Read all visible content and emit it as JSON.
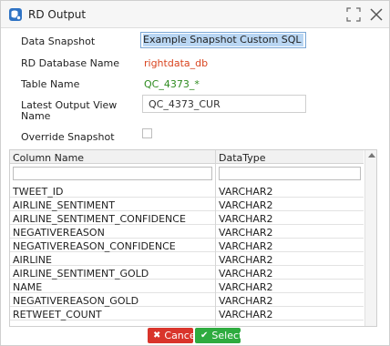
{
  "window": {
    "title": "RD Output"
  },
  "form": {
    "data_snapshot_label": "Data Snapshot",
    "data_snapshot_value": "Example Snapshot Custom SQL Result",
    "database_label": "RD Database Name",
    "database_value": "rightdata_db",
    "table_label": "Table Name",
    "table_value": "QC_4373_*",
    "view_label_line1": "Latest Output View",
    "view_label_line2": "Name",
    "view_value": "QC_4373_CUR",
    "override_label": "Override Snapshot",
    "override_checked": false
  },
  "grid": {
    "columns": [
      "Column Name",
      "DataType"
    ],
    "rows": [
      [
        "TWEET_ID",
        "VARCHAR2"
      ],
      [
        "AIRLINE_SENTIMENT",
        "VARCHAR2"
      ],
      [
        "AIRLINE_SENTIMENT_CONFIDENCE",
        "VARCHAR2"
      ],
      [
        "NEGATIVEREASON",
        "VARCHAR2"
      ],
      [
        "NEGATIVEREASON_CONFIDENCE",
        "VARCHAR2"
      ],
      [
        "AIRLINE",
        "VARCHAR2"
      ],
      [
        "AIRLINE_SENTIMENT_GOLD",
        "VARCHAR2"
      ],
      [
        "NAME",
        "VARCHAR2"
      ],
      [
        "NEGATIVEREASON_GOLD",
        "VARCHAR2"
      ],
      [
        "RETWEET_COUNT",
        "VARCHAR2"
      ]
    ]
  },
  "buttons": {
    "cancel_label": "Cancel",
    "select_label": "Select"
  },
  "colors": {
    "database_value": "#d9441f",
    "table_value": "#2e8b1f",
    "cancel": "#d9342b",
    "select": "#2eab3f"
  }
}
